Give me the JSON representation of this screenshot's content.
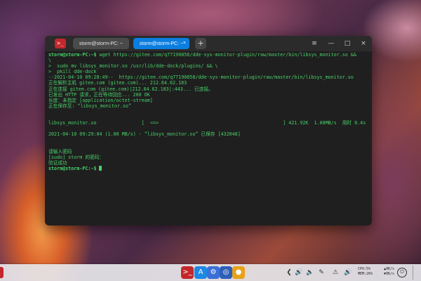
{
  "terminal": {
    "app_icon_label": ">_",
    "tabs": [
      {
        "label": "storm@storm-PC: ~"
      },
      {
        "label": "storm@storm-PC: ~",
        "close": "×"
      }
    ],
    "add_tab": "+",
    "controls": {
      "menu": "≡",
      "minimize": "—",
      "maximize": "□",
      "close": "×"
    },
    "lines": [
      {
        "prompt": "storm@storm-PC:~$",
        "text": " wget https://gitee.com/q77190858/dde-sys-monitor-plugin/raw/master/bin/libsys_monitor.so &&"
      },
      {
        "text": "\\"
      },
      {
        "text": ">  sudo mv libsys_monitor.so /usr/lib/dde-dock/plugins/ && \\"
      },
      {
        "text": ">  pkill dde-dock"
      },
      {
        "text": "--2021-04-10 09:28:49--  https://gitee.com/q77190858/dde-sys-monitor-plugin/raw/master/bin/libsys_monitor.so"
      },
      {
        "text": "正在解析主机 gitee.com (gitee.com)... 212.64.62.183"
      },
      {
        "text": "正在连接 gitee.com (gitee.com)|212.64.62.183|:443... 已连接。"
      },
      {
        "text": "已发出 HTTP 请求，正在等待回应... 200 OK"
      },
      {
        "text": "长度：未指定 [application/octet-stream]"
      },
      {
        "text": "正在保存至: “libsys_monitor.so”"
      },
      {
        "text": ""
      },
      {
        "text": ""
      },
      {
        "text": "libsys_monitor.so                [  <=>                                            ] 421.92K  1.00MB/s  用时 0.4s"
      },
      {
        "text": ""
      },
      {
        "text": "2021-04-10 09:29:04 (1.00 MB/s) - “libsys_monitor.so” 已保存 [432048]"
      },
      {
        "text": ""
      },
      {
        "text": ""
      },
      {
        "text": "请输入密码"
      },
      {
        "text": "[sudo] storm 的密码："
      },
      {
        "text": "验证成功"
      },
      {
        "prompt": "storm@storm-PC:~$",
        "text": " ",
        "cursor": true
      }
    ]
  },
  "dock": {
    "apps": [
      {
        "name": "terminal",
        "label": ">_",
        "color": "#c3272b"
      },
      {
        "name": "app-store",
        "label": "A",
        "color": "#1e88e5"
      },
      {
        "name": "settings",
        "label": "⚙",
        "color": "#3a6fd8"
      },
      {
        "name": "browser",
        "label": "◎",
        "color": "#2e5fb8"
      },
      {
        "name": "chrome",
        "label": "●",
        "color": "#e8a21a"
      }
    ],
    "tray": [
      "❮",
      "🔊",
      "🔈",
      "✎",
      "⚠",
      "🔊"
    ],
    "monitor": {
      "cpu_label": "CPU:",
      "cpu_value": "5%",
      "mem_label": "MEM:",
      "mem_value": "26%",
      "up_label": "▲",
      "up_value": "0K/s",
      "down_label": "▼",
      "down_value": "0K/s"
    },
    "power_icon": "⏻"
  }
}
